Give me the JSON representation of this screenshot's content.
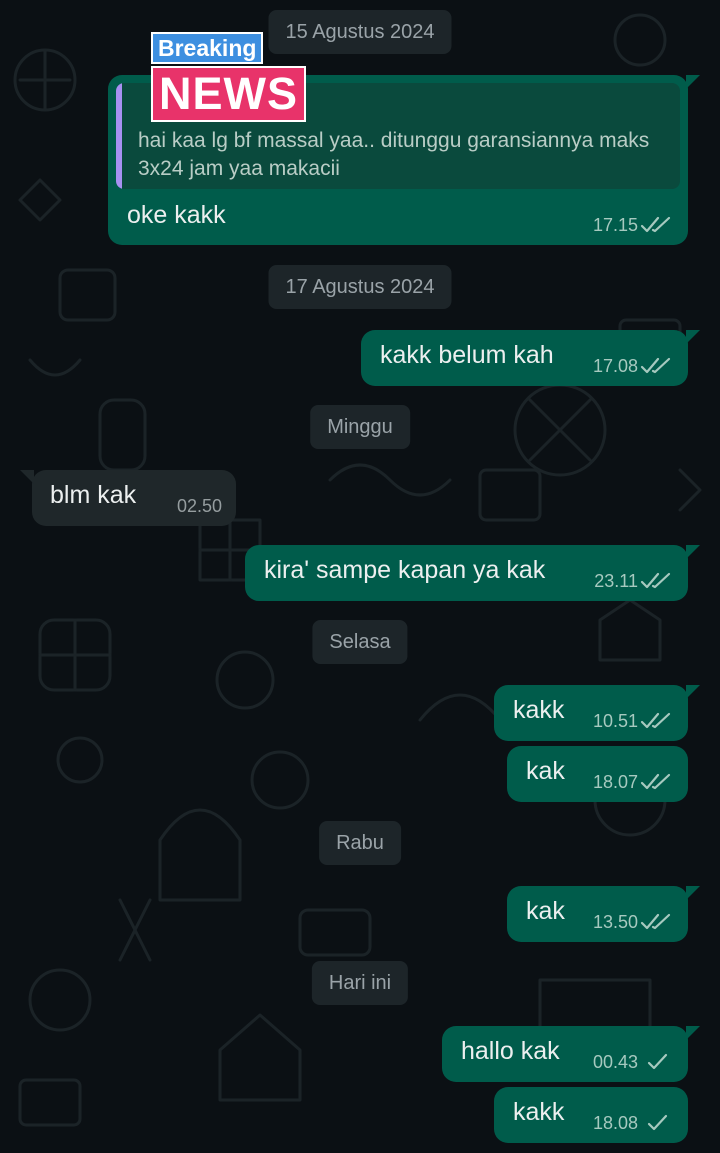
{
  "colors": {
    "background": "#0b1014",
    "outgoing_bubble": "#005c4b",
    "incoming_bubble": "#1f272a",
    "date_chip": "#1d2529",
    "quote_bar": "#a791f2",
    "read_tick": "#a6c9bf"
  },
  "dates": {
    "d1": "15 Agustus 2024",
    "d2": "17 Agustus 2024",
    "d3": "Minggu",
    "d4": "Selasa",
    "d5": "Rabu",
    "d6": "Hari ini"
  },
  "sticker": {
    "line1": "Breaking",
    "line2": "NEWS"
  },
  "messages": {
    "m1": {
      "quoted": "hai kaa lg bf massal yaa.. ditunggu garansiannya maks 3x24 jam yaa makacii",
      "text": "oke kakk",
      "time": "17.15",
      "status": "read"
    },
    "m2": {
      "text": "kakk belum kah",
      "time": "17.08",
      "status": "read"
    },
    "m3": {
      "text": "blm kak",
      "time": "02.50"
    },
    "m4": {
      "text": "kira' sampe kapan ya kak",
      "time": "23.11",
      "status": "read"
    },
    "m5": {
      "text": "kakk",
      "time": "10.51",
      "status": "read"
    },
    "m6": {
      "text": "kak",
      "time": "18.07",
      "status": "read"
    },
    "m7": {
      "text": "kak",
      "time": "13.50",
      "status": "read"
    },
    "m8": {
      "text": "hallo kak",
      "time": "00.43",
      "status": "sent"
    },
    "m9": {
      "text": "kakk",
      "time": "18.08",
      "status": "sent"
    }
  }
}
